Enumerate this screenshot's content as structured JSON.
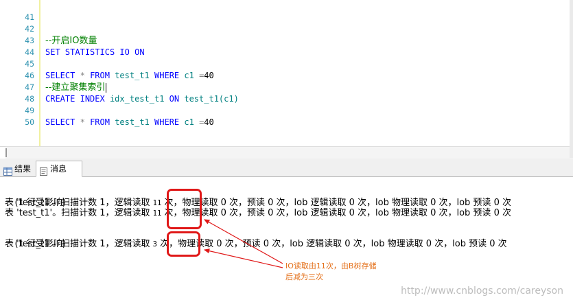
{
  "editor": {
    "lines": [
      {
        "num": "41",
        "kind": "empty"
      },
      {
        "num": "42",
        "kind": "comment",
        "text": "--开启IO数量"
      },
      {
        "num": "43",
        "kind": "set",
        "kw1": "SET",
        "kw2": "STATISTICS",
        "kw3": "IO",
        "kw4": "ON"
      },
      {
        "num": "44",
        "kind": "empty"
      },
      {
        "num": "45",
        "kind": "select",
        "kw_select": "SELECT",
        "star": "*",
        "kw_from": "FROM",
        "table": "test_t1",
        "kw_where": "WHERE",
        "col": "c1",
        "eq": "=",
        "val": "40"
      },
      {
        "num": "46",
        "kind": "comment",
        "text": "--建立聚集索引"
      },
      {
        "num": "47",
        "kind": "create",
        "kw1": "CREATE",
        "kw2": "INDEX",
        "name": "idx_test_t1",
        "kw3": "ON",
        "target": "test_t1(c1)"
      },
      {
        "num": "48",
        "kind": "empty"
      },
      {
        "num": "49",
        "kind": "select",
        "kw_select": "SELECT",
        "star": "*",
        "kw_from": "FROM",
        "table": "test_t1",
        "kw_where": "WHERE",
        "col": "c1",
        "eq": "=",
        "val": "40"
      },
      {
        "num": "50",
        "kind": "empty"
      }
    ]
  },
  "tabs": {
    "results": "结果",
    "messages": "消息"
  },
  "messages": {
    "block1": {
      "rows_affected": "(1 行受影响)",
      "line1_a": "表 'test_t1'。扫描计数 1，逻辑读取 ",
      "line1_reads": "11",
      "line1_b": " 次，物理读取 0 次，预读 0 次，lob 逻辑读取 0 次，lob 物理读取 0 次，lob 预读 0 次",
      "line2_a": "表 'test_t1'。扫描计数 1，逻辑读取 ",
      "line2_reads": "11",
      "line2_b": " 次，物理读取 0 次，预读 0 次，lob 逻辑读取 0 次，lob 物理读取 0 次，lob 预读 0 次"
    },
    "block2": {
      "rows_affected": "(1 行受影响)",
      "line1_a": "表 'test_t1'。扫描计数 1，逻辑读取 ",
      "line1_reads": "3",
      "line1_b": " 次，物理读取 0 次，预读 0 次，lob 逻辑读取 0 次，lob 物理读取 0 次，lob 预读 0 次"
    }
  },
  "annotation": {
    "line1": "IO读取由11次，由B树存储",
    "line2": "后减为三次",
    "color": "#e4701a",
    "box_color": "#e01818"
  },
  "watermark": "http://www.cnblogs.com/careyson"
}
